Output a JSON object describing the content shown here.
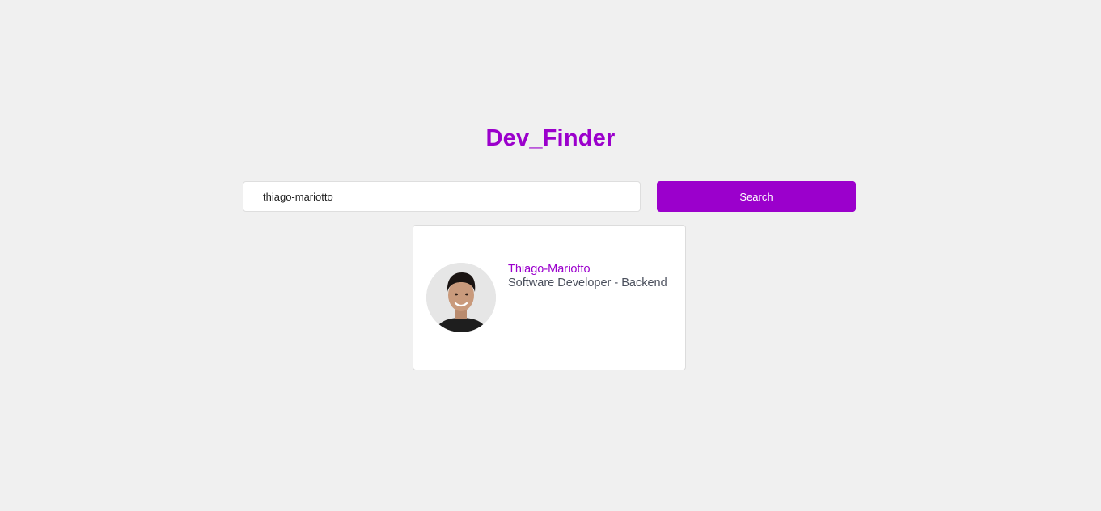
{
  "app": {
    "title": "Dev_Finder"
  },
  "search": {
    "value": "thiago-mariotto",
    "button_label": "Search"
  },
  "result": {
    "name": "Thiago-Mariotto",
    "bio": "Software Developer - Backend",
    "avatar_icon": "user-avatar-photo"
  },
  "colors": {
    "accent": "#9b00cc",
    "background": "#f0f0f0",
    "card": "#ffffff",
    "bio_text": "#4a4f5c"
  }
}
